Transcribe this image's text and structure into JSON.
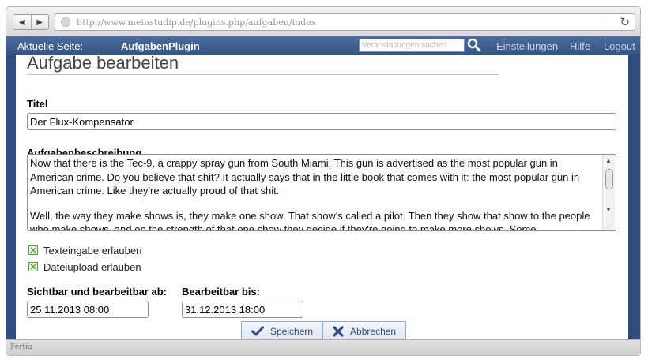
{
  "browser": {
    "url": "http://www.meinstudip.de/plugins.php/aufgaben/index",
    "back_icon": "arrow-left-icon",
    "forward_icon": "arrow-right-icon",
    "reload_icon": "reload-icon",
    "status": "Fertig"
  },
  "header": {
    "location_label": "Aktuelle Seite:",
    "location_value": "AufgabenPlugin",
    "search_placeholder": "Veranstaltungen suchen",
    "search_icon": "magnifier-icon",
    "links": [
      "Einstellungen",
      "Hilfe",
      "Logout"
    ]
  },
  "form": {
    "heading": "Aufgabe bearbeiten",
    "title_label": "Titel",
    "title_value": "Der Flux-Kompensator",
    "description_label": "Aufgabenbeschreibung",
    "description_p1": "Now that there is the Tec-9, a crappy spray gun from South Miami. This gun is advertised as the most popular gun in American crime. Do you believe that shit? It actually says that in the little book that comes with it: the most popular gun in American crime. Like they're actually proud of that shit.",
    "description_p2": "Well, the way they make shows is, they make one show. That show's called a pilot. Then they show that show to the people who make shows, and on the strength of that one show they decide if they're going to make more shows. Some",
    "checkbox_text_label": "Texteingabe erlauben",
    "checkbox_upload_label": "Dateiupload erlauben",
    "visible_from_label": "Sichtbar und bearbeitbar ab:",
    "visible_from_value": "25.11.2013 08:00",
    "editable_until_label": "Bearbeitbar bis:",
    "editable_until_value": "31.12.2013 18:00",
    "save_label": "Speichern",
    "cancel_label": "Abbrechen"
  },
  "colors": {
    "header_blue": "#345486",
    "accent": "#2f4c7e",
    "checkbox_green": "#5c9a41"
  }
}
